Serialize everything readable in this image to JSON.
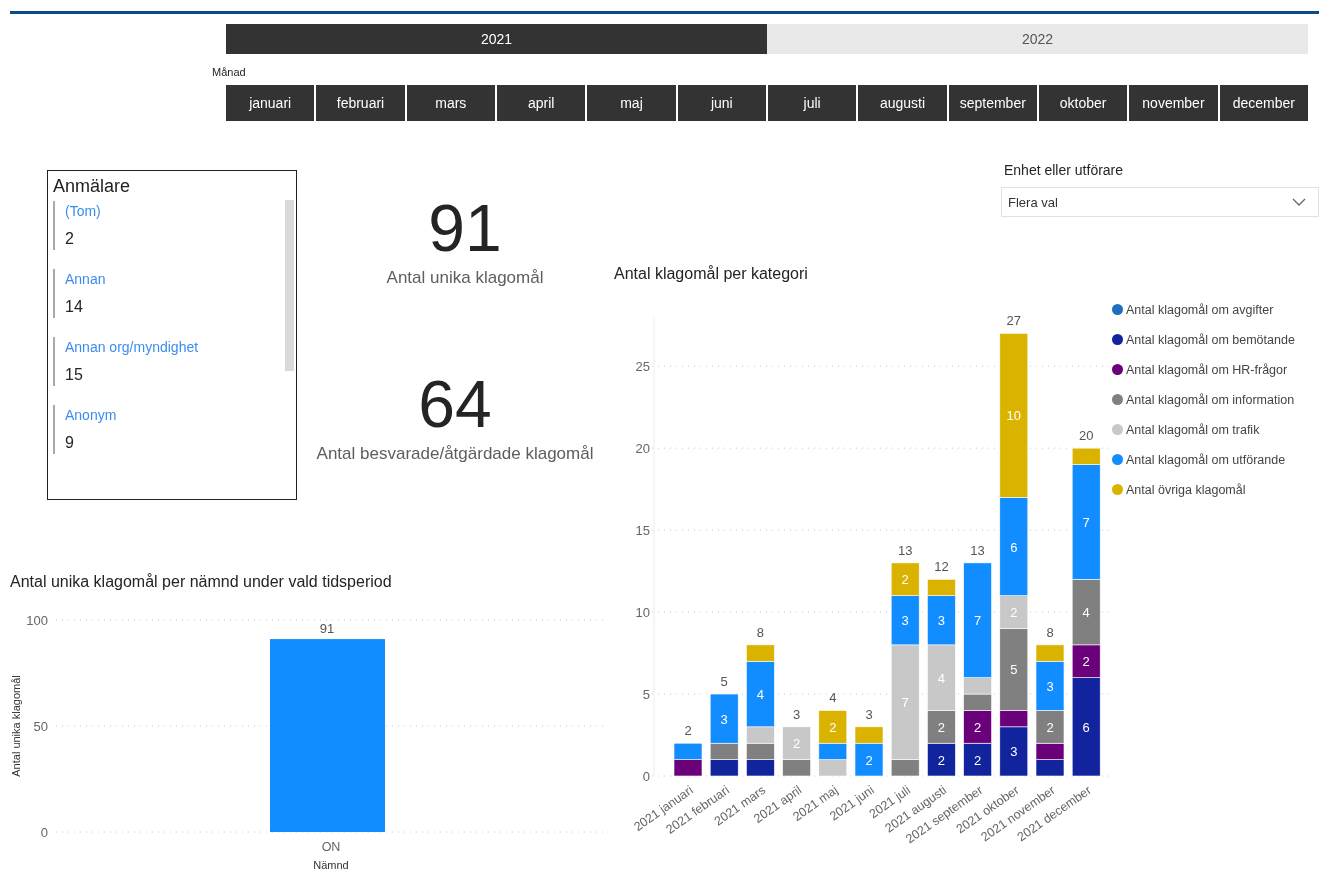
{
  "year_slicer": {
    "items": [
      {
        "label": "2021",
        "selected": true
      },
      {
        "label": "2022",
        "selected": false
      }
    ]
  },
  "month_slicer": {
    "title": "Månad",
    "items": [
      {
        "label": "januari",
        "selected": true
      },
      {
        "label": "februari",
        "selected": true
      },
      {
        "label": "mars",
        "selected": true
      },
      {
        "label": "april",
        "selected": true
      },
      {
        "label": "maj",
        "selected": true
      },
      {
        "label": "juni",
        "selected": true
      },
      {
        "label": "juli",
        "selected": true
      },
      {
        "label": "augusti",
        "selected": true
      },
      {
        "label": "september",
        "selected": true
      },
      {
        "label": "oktober",
        "selected": true
      },
      {
        "label": "november",
        "selected": true
      },
      {
        "label": "december",
        "selected": true
      }
    ]
  },
  "reporter_slicer": {
    "title": "Anmälare",
    "items": [
      {
        "name": "(Tom)",
        "value": "2"
      },
      {
        "name": "Annan",
        "value": "14"
      },
      {
        "name": "Annan org/myndighet",
        "value": "15"
      },
      {
        "name": "Anonym",
        "value": "9"
      }
    ]
  },
  "kpis": [
    {
      "value": "91",
      "label": "Antal unika klagomål"
    },
    {
      "value": "64",
      "label": "Antal besvarade/åtgärdade klagomål"
    }
  ],
  "unit_filter": {
    "title": "Enhet eller utförare",
    "value": "Flera val"
  },
  "category_chart": {
    "total_labels": [
      "2",
      "5",
      "8",
      "3",
      "4",
      "3",
      "13",
      "12",
      "13",
      "27",
      "8",
      "20"
    ],
    "chart_data": {
      "type": "bar",
      "stacked": true,
      "grid": true,
      "title": "Antal klagomål per kategori",
      "categories": [
        "2021 januari",
        "2021 februari",
        "2021 mars",
        "2021 april",
        "2021 maj",
        "2021 juni",
        "2021 juli",
        "2021 augusti",
        "2021 september",
        "2021 oktober",
        "2021 november",
        "2021 december"
      ],
      "ylim": [
        0,
        28
      ],
      "yticks": [
        0,
        5,
        10,
        15,
        20,
        25
      ],
      "series": [
        {
          "name": "Antal klagomål om avgifter",
          "color": "#1f6fc0",
          "values": [
            0,
            0,
            0,
            0,
            0,
            0,
            0,
            0,
            0,
            0,
            0,
            0
          ],
          "value_labels": [
            null,
            null,
            null,
            null,
            null,
            null,
            null,
            null,
            null,
            null,
            null,
            null
          ]
        },
        {
          "name": "Antal klagomål om bemötande",
          "color": "#12239e",
          "values": [
            0,
            1,
            1,
            0,
            0,
            0,
            0,
            2,
            2,
            3,
            1,
            6
          ],
          "value_labels": [
            null,
            null,
            null,
            null,
            null,
            null,
            null,
            "2",
            "2",
            "3",
            null,
            "6"
          ]
        },
        {
          "name": "Antal klagomål om HR-frågor",
          "color": "#6b007b",
          "values": [
            1,
            0,
            0,
            0,
            0,
            0,
            0,
            0,
            2,
            1,
            1,
            2
          ],
          "value_labels": [
            null,
            null,
            null,
            null,
            null,
            null,
            null,
            null,
            "2",
            null,
            null,
            "2"
          ]
        },
        {
          "name": "Antal klagomål om information",
          "color": "#808080",
          "values": [
            0,
            1,
            1,
            1,
            0,
            0,
            1,
            2,
            1,
            5,
            2,
            4
          ],
          "value_labels": [
            null,
            null,
            null,
            null,
            null,
            null,
            null,
            "2",
            null,
            "5",
            "2",
            "4"
          ]
        },
        {
          "name": "Antal klagomål om trafik",
          "color": "#c8c8c8",
          "values": [
            0,
            0,
            1,
            2,
            1,
            0,
            7,
            4,
            1,
            2,
            0,
            0
          ],
          "value_labels": [
            null,
            null,
            null,
            "2",
            null,
            null,
            "7",
            "4",
            null,
            "2",
            null,
            null
          ]
        },
        {
          "name": "Antal klagomål om utförande",
          "color": "#118dff",
          "values": [
            1,
            3,
            4,
            0,
            1,
            2,
            3,
            3,
            7,
            6,
            3,
            7
          ],
          "value_labels": [
            null,
            "3",
            "4",
            null,
            null,
            "2",
            "3",
            "3",
            "7",
            "6",
            "3",
            "7"
          ]
        },
        {
          "name": "Antal övriga klagomål",
          "color": "#d9b300",
          "values": [
            0,
            0,
            1,
            0,
            2,
            1,
            2,
            1,
            0,
            10,
            1,
            1
          ],
          "value_labels": [
            null,
            null,
            null,
            null,
            "2",
            null,
            "2",
            null,
            null,
            "10",
            null,
            null
          ]
        }
      ]
    }
  },
  "board_chart": {
    "chart_data": {
      "type": "bar",
      "grid": true,
      "title": "Antal unika klagomål per nämnd under vald tidsperiod",
      "xlabel": "Nämnd",
      "ylabel": "Antal unika klagomål",
      "categories": [
        "ON"
      ],
      "ylim": [
        0,
        100
      ],
      "yticks": [
        0,
        50,
        100
      ],
      "series": [
        {
          "color": "#118dff",
          "values": [
            91
          ],
          "value_labels": [
            "91"
          ]
        }
      ]
    }
  }
}
